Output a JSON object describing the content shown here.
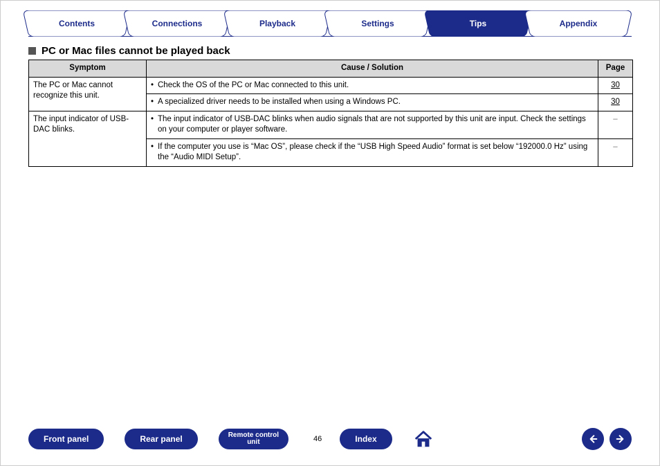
{
  "tabs": {
    "items": [
      {
        "label": "Contents"
      },
      {
        "label": "Connections"
      },
      {
        "label": "Playback"
      },
      {
        "label": "Settings"
      },
      {
        "label": "Tips"
      },
      {
        "label": "Appendix"
      }
    ],
    "active_index": 4
  },
  "section": {
    "title": "PC or Mac files cannot be played back"
  },
  "table": {
    "headers": {
      "symptom": "Symptom",
      "cause": "Cause / Solution",
      "page": "Page"
    },
    "rows": [
      {
        "symptom": "The PC or Mac cannot recognize this unit.",
        "causes": [
          {
            "text": "Check the OS of the PC or Mac connected to this unit.",
            "page": "30"
          },
          {
            "text": "A specialized driver needs to be installed when using a Windows PC.",
            "page": "30"
          }
        ]
      },
      {
        "symptom": "The input indicator of USB-DAC blinks.",
        "causes": [
          {
            "text": "The input indicator of USB-DAC blinks when audio signals that are not supported by this unit are input. Check the settings on your computer or player software.",
            "page": "–"
          },
          {
            "text": "If the computer you use is “Mac OS”, please check if the “USB High Speed Audio” format is set below “192000.0 Hz” using the “Audio MIDI Setup”.",
            "page": "–"
          }
        ]
      }
    ]
  },
  "footer": {
    "front": "Front panel",
    "rear": "Rear panel",
    "remote": "Remote control\nunit",
    "index": "Index",
    "page": "46"
  }
}
